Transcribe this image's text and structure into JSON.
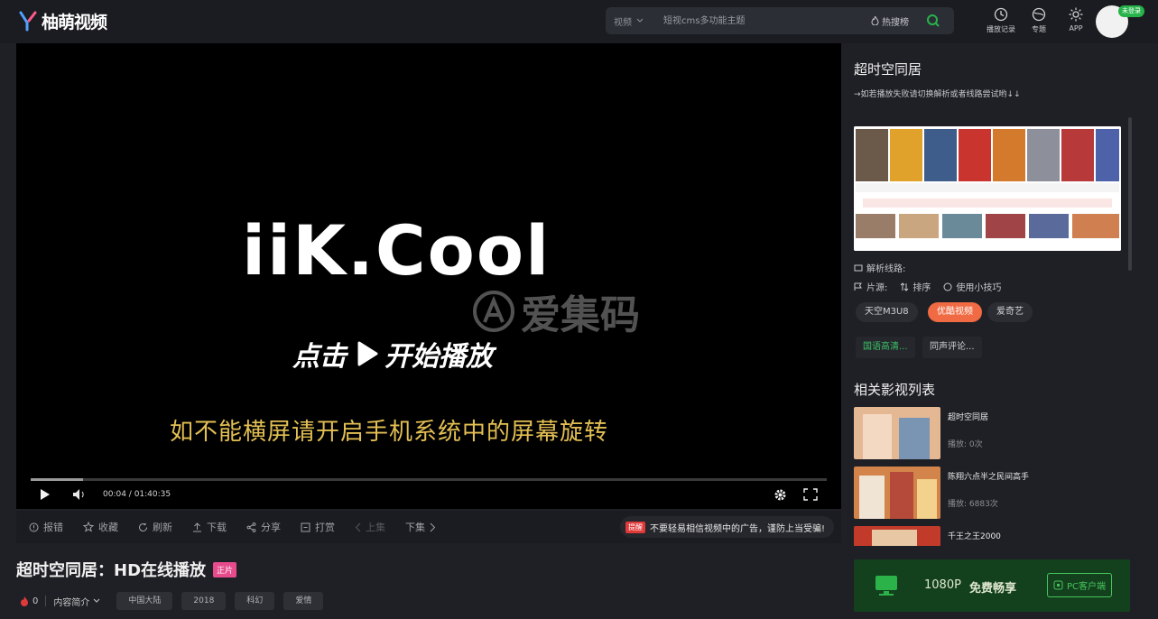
{
  "header": {
    "logo_text": "柚萌视频",
    "search": {
      "category": "视频",
      "placeholder": "短视cms多功能主题",
      "hot_label": "热搜榜"
    },
    "history_label": "播放记录",
    "topics_label": "专题",
    "app_label": "APP",
    "login_badge": "未登录"
  },
  "player": {
    "brand": "iiK.Cool",
    "watermark": "爱集码",
    "play_cta": "点击",
    "play_cta_tail": "开始播放",
    "rotate_tip": "如不能横屏请开启手机系统中的屏幕旋转",
    "time": "00:04 / 01:40:35",
    "progress": 0.066
  },
  "actions": {
    "report": "报错",
    "favorite": "收藏",
    "refresh": "刷新",
    "download": "下载",
    "share": "分享",
    "reward": "打赏",
    "prev": "上集",
    "next": "下集",
    "ad_badge": "提醒",
    "ad_tip": "不要轻易相信视频中的广告，谨防上当受骗!"
  },
  "video": {
    "title": "超时空同居：HD在线播放",
    "tag": "正片",
    "likes": "0",
    "intro_label": "内容简介",
    "tags": [
      "中国大陆",
      "2018",
      "科幻",
      "爱情"
    ]
  },
  "sidebar": {
    "title": "超时空同居",
    "hint": "→如若播放失败请切换解析或者线路尝试哟↓↓",
    "line_label": "解析线路:",
    "tools": {
      "intro": "片源:",
      "sort": "排序",
      "tips": "使用小技巧"
    },
    "sources": [
      "天空M3U8",
      "优酷视频",
      "爱奇艺"
    ],
    "episodes": [
      "国语高清...",
      "同声评论..."
    ],
    "related_title": "相关影视列表",
    "related": [
      {
        "name": "超时空同居",
        "plays": "播放: 0次"
      },
      {
        "name": "陈翔六点半之民间高手",
        "plays": "播放: 6883次"
      },
      {
        "name": "千王之王2000",
        "plays": ""
      }
    ],
    "pc_banner": {
      "resolution": "1080P",
      "free": "免费畅享",
      "client": "PC客户端"
    }
  },
  "colors": {
    "accent_orange": "#f06a43",
    "accent_green": "#26b34a",
    "subtitle_yellow": "#e3bf53",
    "tag_pink": "#e74b8c"
  }
}
